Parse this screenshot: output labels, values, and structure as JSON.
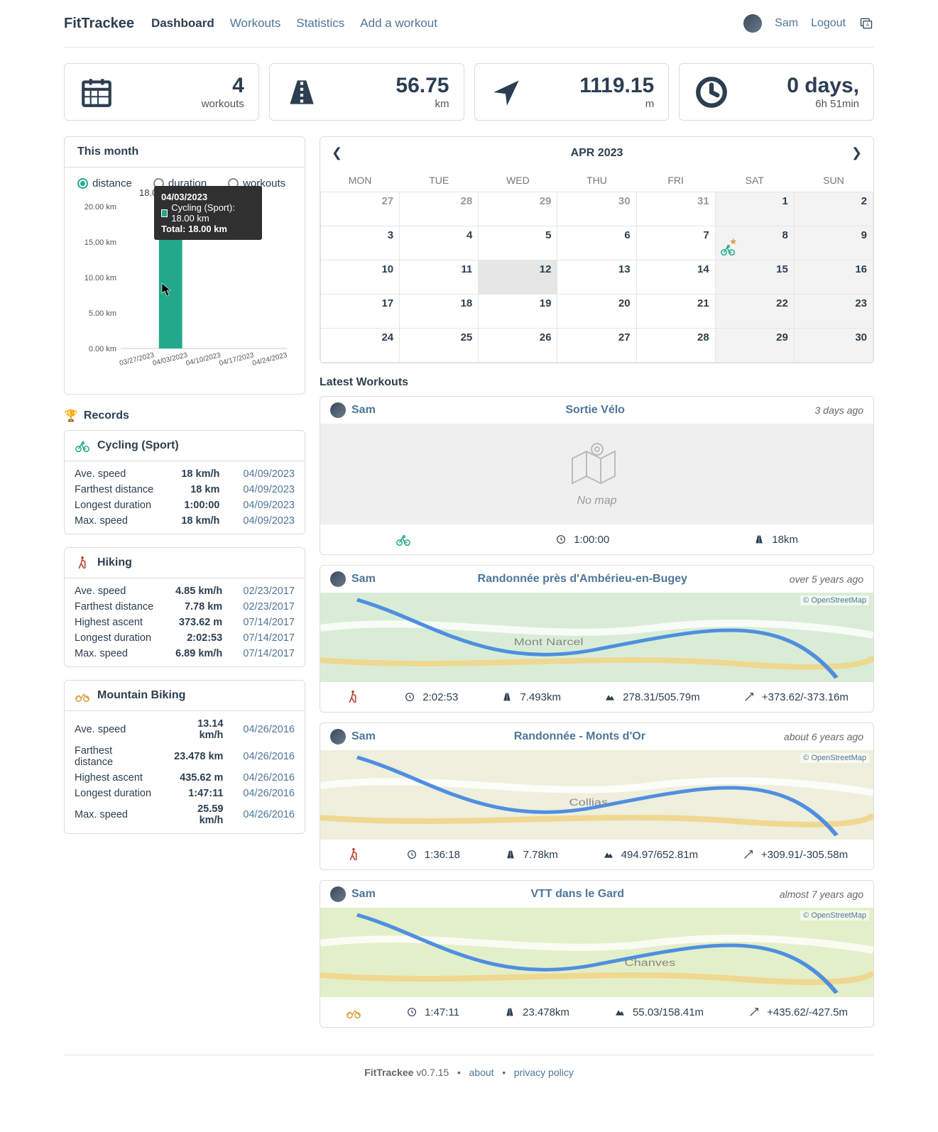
{
  "brand": "FitTrackee",
  "nav": {
    "dashboard": "Dashboard",
    "workouts": "Workouts",
    "statistics": "Statistics",
    "add": "Add a workout"
  },
  "user": {
    "name": "Sam",
    "logout": "Logout"
  },
  "stats": {
    "workouts": {
      "value": "4",
      "unit": "workouts"
    },
    "distance": {
      "value": "56.75",
      "unit": "km"
    },
    "elevation": {
      "value": "1119.15",
      "unit": "m"
    },
    "duration": {
      "value": "0 days,",
      "unit": "6h 51min"
    }
  },
  "monthChart": {
    "title": "This month",
    "metrics": {
      "distance": "distance",
      "duration": "duration",
      "workouts": "workouts"
    },
    "barLabel": "18.00",
    "tooltip": {
      "date": "04/03/2023",
      "series": "Cycling (Sport): 18.00 km",
      "total": "Total: 18.00 km"
    }
  },
  "chart_data": {
    "type": "bar",
    "categories": [
      "03/27/2023",
      "04/03/2023",
      "04/10/2023",
      "04/17/2023",
      "04/24/2023"
    ],
    "series": [
      {
        "name": "Cycling (Sport)",
        "values": [
          0,
          18.0,
          0,
          0,
          0
        ]
      }
    ],
    "ylabel": "km",
    "ylim": [
      0,
      20
    ],
    "yticks": [
      "0.00 km",
      "5.00 km",
      "10.00 km",
      "15.00 km",
      "20.00 km"
    ],
    "title": "This month – distance"
  },
  "records": {
    "title": "Records",
    "tables": [
      {
        "sport": "Cycling (Sport)",
        "color": "#22a98b",
        "icon": "bike",
        "rows": [
          {
            "label": "Ave. speed",
            "value": "18 km/h",
            "date": "04/09/2023"
          },
          {
            "label": "Farthest distance",
            "value": "18 km",
            "date": "04/09/2023"
          },
          {
            "label": "Longest duration",
            "value": "1:00:00",
            "date": "04/09/2023"
          },
          {
            "label": "Max. speed",
            "value": "18 km/h",
            "date": "04/09/2023"
          }
        ]
      },
      {
        "sport": "Hiking",
        "color": "#b94739",
        "icon": "hiker",
        "rows": [
          {
            "label": "Ave. speed",
            "value": "4.85 km/h",
            "date": "02/23/2017"
          },
          {
            "label": "Farthest distance",
            "value": "7.78 km",
            "date": "02/23/2017"
          },
          {
            "label": "Highest ascent",
            "value": "373.62 m",
            "date": "07/14/2017"
          },
          {
            "label": "Longest duration",
            "value": "2:02:53",
            "date": "07/14/2017"
          },
          {
            "label": "Max. speed",
            "value": "6.89 km/h",
            "date": "07/14/2017"
          }
        ]
      },
      {
        "sport": "Mountain Biking",
        "color": "#d8a03d",
        "icon": "mtb",
        "rows": [
          {
            "label": "Ave. speed",
            "value": "13.14 km/h",
            "date": "04/26/2016"
          },
          {
            "label": "Farthest distance",
            "value": "23.478 km",
            "date": "04/26/2016"
          },
          {
            "label": "Highest ascent",
            "value": "435.62 m",
            "date": "04/26/2016"
          },
          {
            "label": "Longest duration",
            "value": "1:47:11",
            "date": "04/26/2016"
          },
          {
            "label": "Max. speed",
            "value": "25.59 km/h",
            "date": "04/26/2016"
          }
        ]
      }
    ]
  },
  "calendar": {
    "month": "APR 2023",
    "dow": [
      "MON",
      "TUE",
      "WED",
      "THU",
      "FRI",
      "SAT",
      "SUN"
    ],
    "weeks": [
      [
        {
          "d": "27",
          "other": true
        },
        {
          "d": "28",
          "other": true
        },
        {
          "d": "29",
          "other": true
        },
        {
          "d": "30",
          "other": true
        },
        {
          "d": "31",
          "other": true
        },
        {
          "d": "1",
          "we": true
        },
        {
          "d": "2",
          "we": true
        }
      ],
      [
        {
          "d": "3"
        },
        {
          "d": "4"
        },
        {
          "d": "5"
        },
        {
          "d": "6"
        },
        {
          "d": "7"
        },
        {
          "d": "8",
          "we": true,
          "event": "bike"
        },
        {
          "d": "9",
          "we": true
        }
      ],
      [
        {
          "d": "10"
        },
        {
          "d": "11"
        },
        {
          "d": "12",
          "today": true
        },
        {
          "d": "13"
        },
        {
          "d": "14"
        },
        {
          "d": "15",
          "we": true
        },
        {
          "d": "16",
          "we": true
        }
      ],
      [
        {
          "d": "17"
        },
        {
          "d": "18"
        },
        {
          "d": "19"
        },
        {
          "d": "20"
        },
        {
          "d": "21"
        },
        {
          "d": "22",
          "we": true
        },
        {
          "d": "23",
          "we": true
        }
      ],
      [
        {
          "d": "24"
        },
        {
          "d": "25"
        },
        {
          "d": "26"
        },
        {
          "d": "27"
        },
        {
          "d": "28"
        },
        {
          "d": "29",
          "we": true
        },
        {
          "d": "30",
          "we": true
        }
      ]
    ]
  },
  "latest": {
    "title": "Latest Workouts",
    "osm": "© OpenStreetMap",
    "nomap": "No map",
    "items": [
      {
        "user": "Sam",
        "title": "Sortie Vélo",
        "ago": "3 days ago",
        "map": false,
        "sport": "bike",
        "sportColor": "#22a98b",
        "stats": [
          {
            "icon": "clock",
            "text": "1:00:00"
          },
          {
            "icon": "road",
            "text": "18km"
          }
        ]
      },
      {
        "user": "Sam",
        "title": "Randonnée près d'Ambérieu-en-Bugey",
        "ago": "over 5 years ago",
        "map": true,
        "sport": "hiker",
        "sportColor": "#b94739",
        "stats": [
          {
            "icon": "clock",
            "text": "2:02:53"
          },
          {
            "icon": "road",
            "text": "7.493km"
          },
          {
            "icon": "mountain",
            "text": "278.31/505.79m"
          },
          {
            "icon": "arrows",
            "text": "+373.62/-373.16m"
          }
        ]
      },
      {
        "user": "Sam",
        "title": "Randonnée - Monts d'Or",
        "ago": "about 6 years ago",
        "map": true,
        "sport": "hiker",
        "sportColor": "#b94739",
        "stats": [
          {
            "icon": "clock",
            "text": "1:36:18"
          },
          {
            "icon": "road",
            "text": "7.78km"
          },
          {
            "icon": "mountain",
            "text": "494.97/652.81m"
          },
          {
            "icon": "arrows",
            "text": "+309.91/-305.58m"
          }
        ]
      },
      {
        "user": "Sam",
        "title": "VTT dans le Gard",
        "ago": "almost 7 years ago",
        "map": true,
        "sport": "mtb",
        "sportColor": "#d8a03d",
        "stats": [
          {
            "icon": "clock",
            "text": "1:47:11"
          },
          {
            "icon": "road",
            "text": "23.478km"
          },
          {
            "icon": "mountain",
            "text": "55.03/158.41m"
          },
          {
            "icon": "arrows",
            "text": "+435.62/-427.5m"
          }
        ]
      }
    ]
  },
  "footer": {
    "app": "FitTrackee",
    "version": "v0.7.15",
    "about": "about",
    "privacy": "privacy policy"
  }
}
